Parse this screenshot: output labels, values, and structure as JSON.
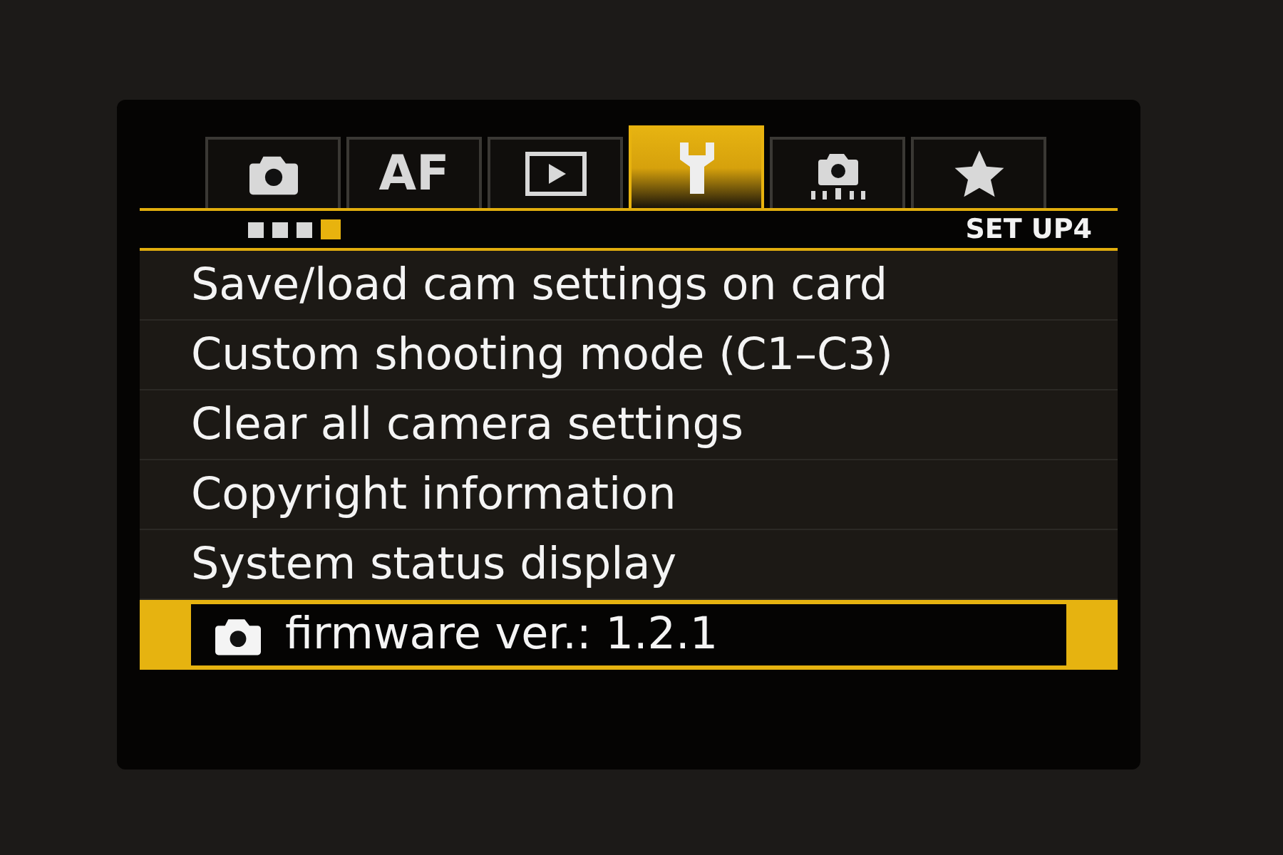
{
  "tabs": [
    {
      "kind": "camera",
      "selected": false
    },
    {
      "kind": "text",
      "label": "AF",
      "selected": false
    },
    {
      "kind": "playback",
      "selected": false
    },
    {
      "kind": "wrench",
      "selected": true
    },
    {
      "kind": "camera-dots",
      "selected": false
    },
    {
      "kind": "star",
      "selected": false
    }
  ],
  "pages": [
    {
      "selected": false
    },
    {
      "selected": false
    },
    {
      "selected": false
    },
    {
      "selected": true
    }
  ],
  "page_title": "SET UP4",
  "menu_items": [
    {
      "label": "Save/load cam settings on card",
      "selected": false
    },
    {
      "label": "Custom shooting mode (C1–C3)",
      "selected": false
    },
    {
      "label": "Clear all camera settings",
      "selected": false
    },
    {
      "label": "Copyright information",
      "selected": false
    },
    {
      "label": "System status display",
      "selected": false
    },
    {
      "label": "firmware ver.: 1.2.1",
      "kind": "camera-label",
      "selected": true
    }
  ]
}
